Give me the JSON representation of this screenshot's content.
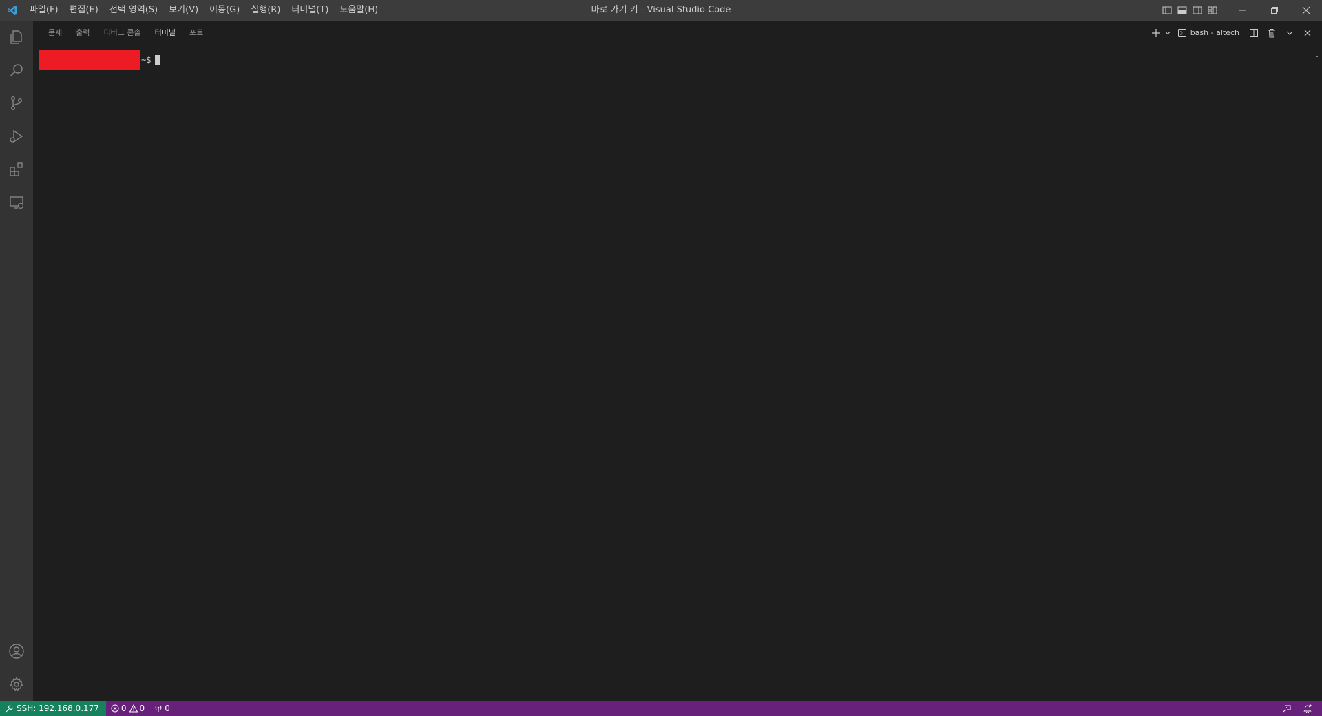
{
  "window": {
    "title": "바로 가기 키 - Visual Studio Code"
  },
  "menu": {
    "items": [
      "파일(F)",
      "편집(E)",
      "선택 영역(S)",
      "보기(V)",
      "이동(G)",
      "실행(R)",
      "터미널(T)",
      "도움말(H)"
    ]
  },
  "activity": {
    "items": [
      "explorer-icon",
      "search-icon",
      "source-control-icon",
      "run-debug-icon",
      "extensions-icon",
      "remote-explorer-icon"
    ],
    "bottom": [
      "accounts-icon",
      "manage-gear-icon"
    ]
  },
  "panel": {
    "tabs": [
      {
        "label": "문제",
        "active": false
      },
      {
        "label": "출력",
        "active": false
      },
      {
        "label": "디버그 콘솔",
        "active": false
      },
      {
        "label": "터미널",
        "active": true
      },
      {
        "label": "포트",
        "active": false
      }
    ],
    "terminal_name": "bash - altech"
  },
  "terminal": {
    "prompt_suffix": "~$"
  },
  "status": {
    "remote": "SSH: 192.168.0.177",
    "errors": "0",
    "warnings": "0",
    "ports": "0"
  },
  "colors": {
    "titlebar": "#3c3c3c",
    "activitybar": "#333333",
    "panel_bg": "#1e1e1e",
    "statusbar": "#68217a",
    "remote_indicator": "#16825d",
    "redaction": "#ed1c24"
  }
}
